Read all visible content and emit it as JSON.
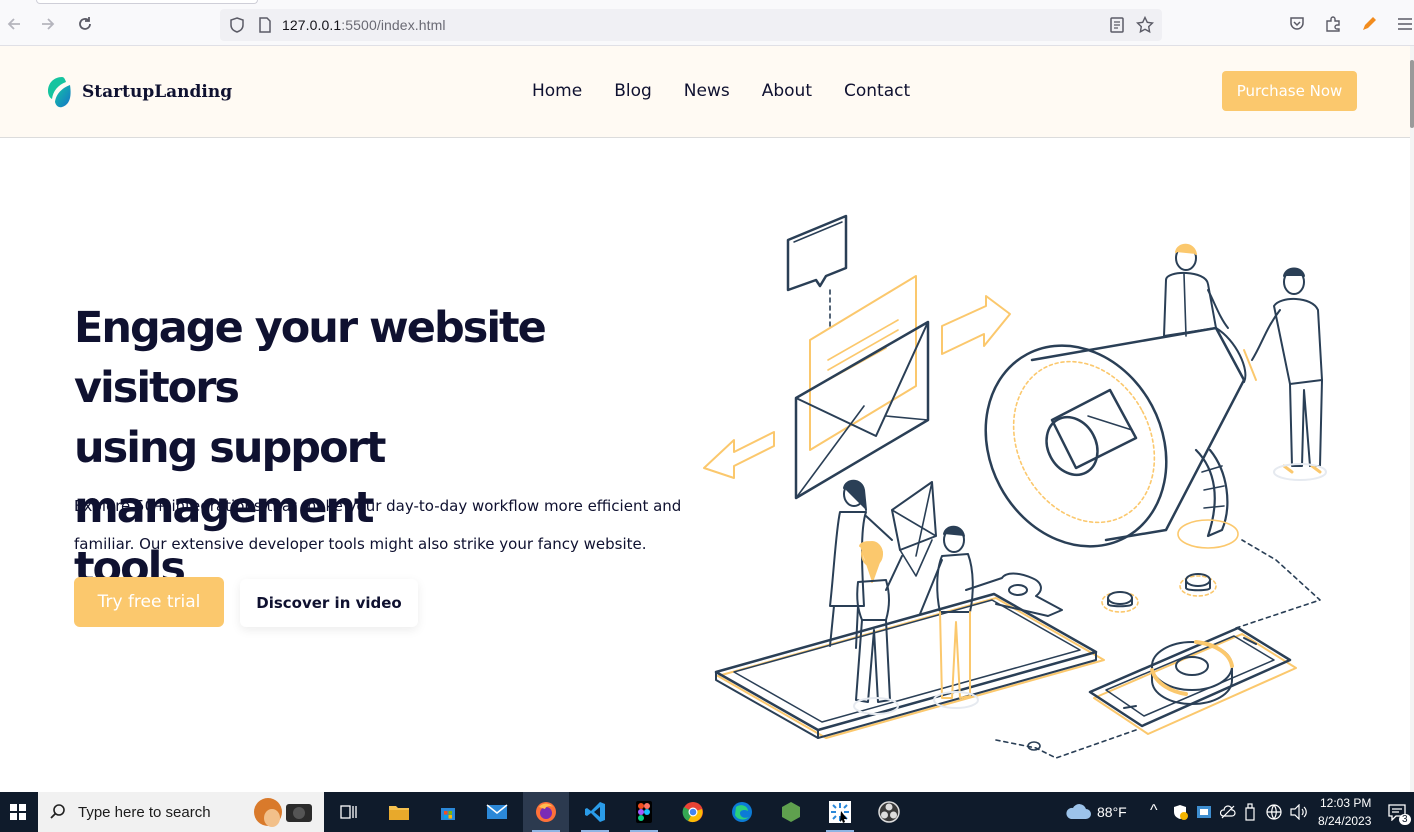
{
  "browser": {
    "url_host": "127.0.0.1",
    "url_rest": ":5500/index.html"
  },
  "site": {
    "logo_text": "StartupLanding",
    "nav": [
      "Home",
      "Blog",
      "News",
      "About",
      "Contact"
    ],
    "purchase_label": "Purchase Now"
  },
  "hero": {
    "title_lines": [
      "Engage your website visitors",
      "using support management",
      "tools"
    ],
    "description": "Explore 50+ integrations that make your day-to-day workflow more efficient and familiar. Our extensive developer tools might also strike your fancy website.",
    "trial_label": "Try free trial",
    "video_label": "Discover in video"
  },
  "taskbar": {
    "search_placeholder": "Type here to search",
    "weather": "88°F",
    "time": "12:03 PM",
    "date": "8/24/2023",
    "notification_count": "3"
  },
  "colors": {
    "accent": "#fbc86d",
    "navy": "#0f1130",
    "header_bg": "#fffaf3"
  }
}
